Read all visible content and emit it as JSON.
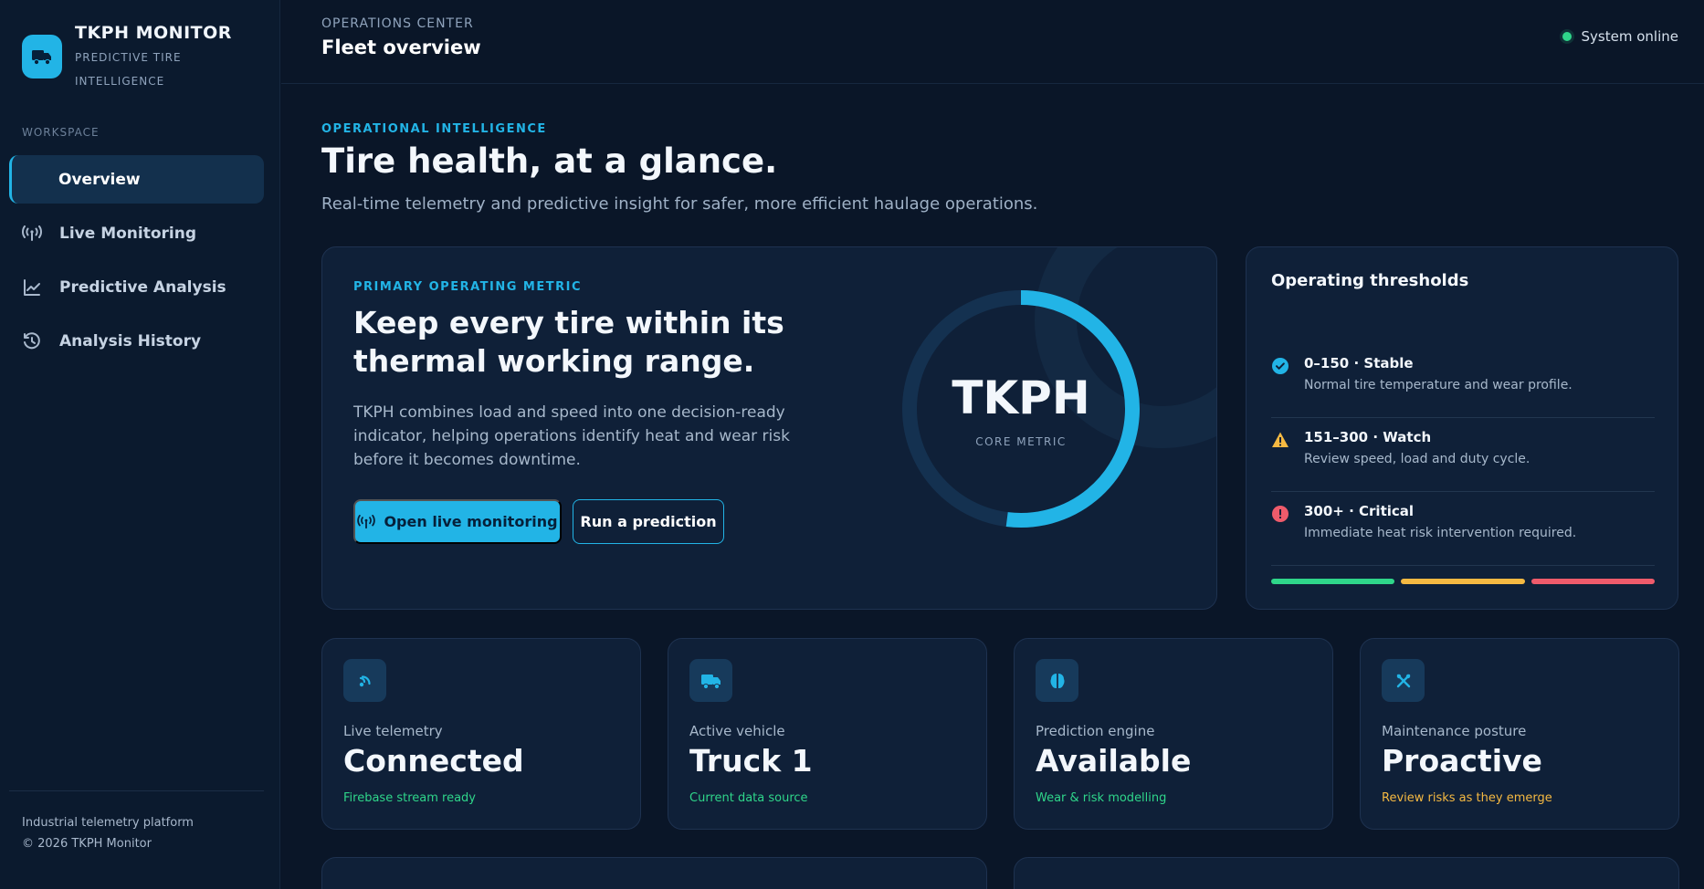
{
  "brand": {
    "title": "TKPH MONITOR",
    "subtitle": "PREDICTIVE TIRE INTELLIGENCE",
    "logo_icon": "truck-icon"
  },
  "sidebar": {
    "section_label": "WORKSPACE",
    "items": [
      {
        "label": "Overview",
        "icon": "none",
        "active": true
      },
      {
        "label": "Live Monitoring",
        "icon": "broadcast-icon",
        "active": false
      },
      {
        "label": "Predictive Analysis",
        "icon": "chart-line-icon",
        "active": false
      },
      {
        "label": "Analysis History",
        "icon": "history-icon",
        "active": false
      }
    ],
    "footer_line1": "Industrial telemetry platform",
    "footer_line2": "© 2026 TKPH Monitor"
  },
  "header": {
    "eyebrow": "OPERATIONS CENTER",
    "title": "Fleet overview",
    "status": "System online"
  },
  "hero": {
    "eyebrow": "OPERATIONAL INTELLIGENCE",
    "title": "Tire health, at a glance.",
    "subtitle": "Real-time telemetry and predictive insight for safer, more efficient haulage operations."
  },
  "metric_card": {
    "eyebrow": "PRIMARY OPERATING METRIC",
    "title": "Keep every tire within its thermal working range.",
    "description": "TKPH combines load and speed into one decision-ready indicator, helping operations identify heat and wear risk before it becomes downtime.",
    "primary_button": "Open live monitoring",
    "secondary_button": "Run a prediction",
    "gauge_label": "TKPH",
    "gauge_sublabel": "CORE METRIC",
    "gauge_fill_fraction": 0.52
  },
  "thresholds": {
    "title": "Operating thresholds",
    "items": [
      {
        "name": "0–150 · Stable",
        "desc": "Normal tire temperature and wear profile.",
        "icon": "check-circle-icon",
        "color": "#22b4e6"
      },
      {
        "name": "151–300 · Watch",
        "desc": "Review speed, load and duty cycle.",
        "icon": "warning-icon",
        "color": "#f5b942"
      },
      {
        "name": "300+ · Critical",
        "desc": "Immediate heat risk intervention required.",
        "icon": "alert-circle-icon",
        "color": "#ef5b6b"
      }
    ],
    "bar_colors": [
      "#2fd68a",
      "#f5b942",
      "#ef5b6b"
    ]
  },
  "stats": [
    {
      "label": "Live telemetry",
      "value": "Connected",
      "note": "Firebase stream ready",
      "icon": "signal-icon",
      "note_color": "#2fd68a"
    },
    {
      "label": "Active vehicle",
      "value": "Truck 1",
      "note": "Current data source",
      "icon": "truck-icon",
      "note_color": "#2fd68a"
    },
    {
      "label": "Prediction engine",
      "value": "Available",
      "note": "Wear & risk modelling",
      "icon": "brain-icon",
      "note_color": "#2fd68a"
    },
    {
      "label": "Maintenance posture",
      "value": "Proactive",
      "note": "Review risks as they emerge",
      "icon": "tools-icon",
      "note_color": "#f5b942"
    }
  ],
  "colors": {
    "accent": "#22b4e6",
    "background": "#0a1628",
    "card": "#0f2038",
    "success": "#2fd68a",
    "warning": "#f5b942",
    "danger": "#ef5b6b"
  }
}
